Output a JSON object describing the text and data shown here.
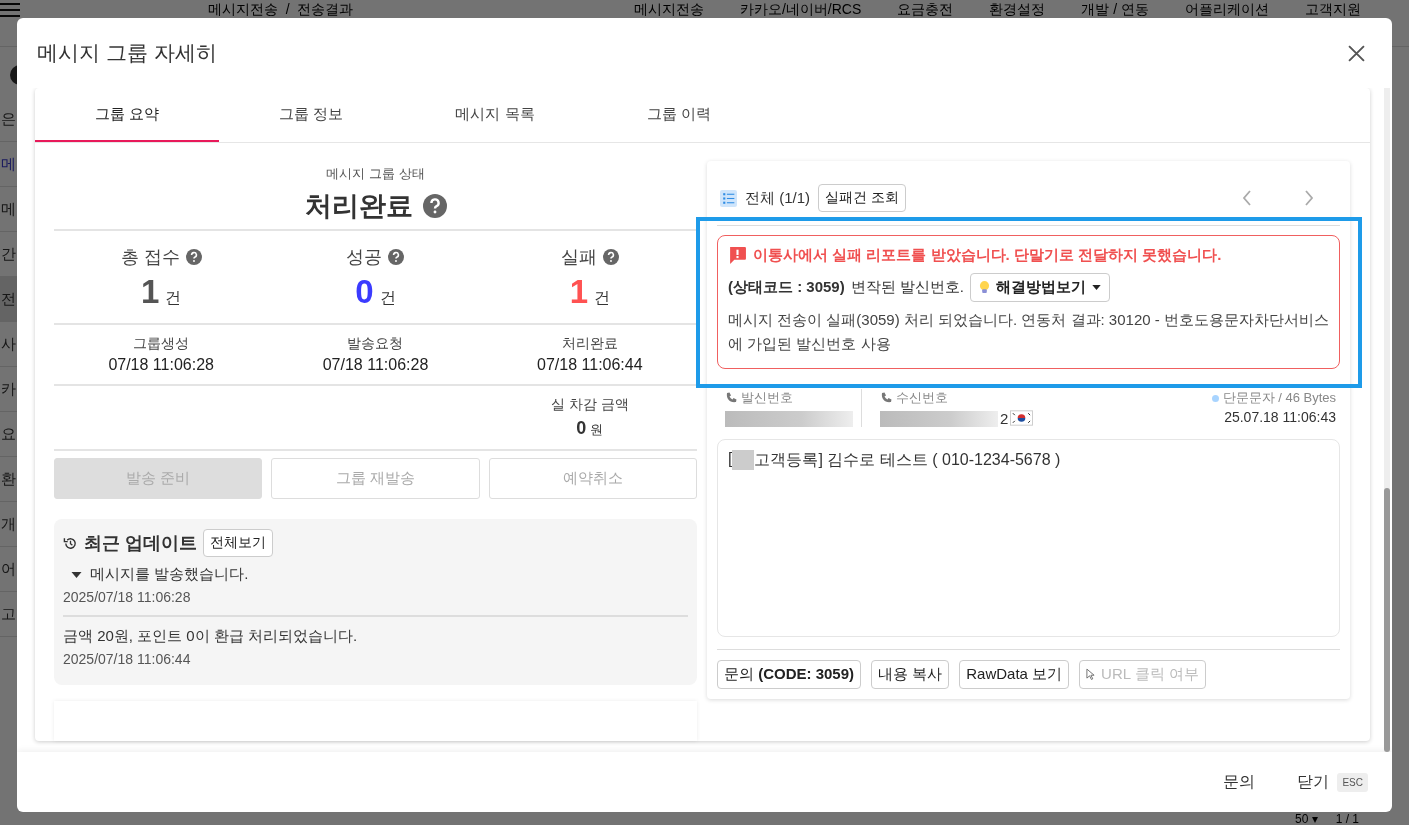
{
  "page": {
    "breadcrumb": "메시지전송  /  전송결과",
    "nav": [
      "메시지전송",
      "카카오/네이버/RCS",
      "요금충전",
      "환경설정",
      "개발 / 연동",
      "어플리케이션",
      "고객지원"
    ],
    "sidebar": [
      {
        "label": "은",
        "selected": false
      },
      {
        "label": "메",
        "selected": false
      },
      {
        "label": "메",
        "selected": false
      },
      {
        "label": "간",
        "selected": false
      },
      {
        "label": "전",
        "selected": true
      },
      {
        "label": "사",
        "selected": false
      },
      {
        "label": "카",
        "selected": false
      },
      {
        "label": "요",
        "selected": false
      },
      {
        "label": "환",
        "selected": false
      },
      {
        "label": "개",
        "selected": false
      },
      {
        "label": "어",
        "selected": false
      },
      {
        "label": "고",
        "selected": false
      }
    ],
    "pager": {
      "page_size": "50 ▾",
      "page": "1 / 1"
    }
  },
  "modal": {
    "title": "메시지 그룹 자세히",
    "tabs": [
      {
        "label": "그룹 요약",
        "selected": true
      },
      {
        "label": "그룹 정보",
        "selected": false
      },
      {
        "label": "메시지 목록",
        "selected": false
      },
      {
        "label": "그룹 이력",
        "selected": false
      }
    ],
    "summary": {
      "status_label": "메시지 그룹 상태",
      "status": "처리완료",
      "stats": [
        {
          "label": "총 접수",
          "value": "1",
          "unit": "건",
          "color": "#555555"
        },
        {
          "label": "성공",
          "value": "0",
          "unit": "건",
          "color": "#3b3bff"
        },
        {
          "label": "실패",
          "value": "1",
          "unit": "건",
          "color": "#ff5252"
        }
      ],
      "times": [
        {
          "label": "그룹생성",
          "value": "07/18 11:06:28"
        },
        {
          "label": "발송요청",
          "value": "07/18 11:06:28"
        },
        {
          "label": "처리완료",
          "value": "07/18 11:06:44"
        }
      ],
      "amount": {
        "label": "실 차감 금액",
        "value": "0",
        "unit": "원"
      },
      "actions": [
        {
          "label": "발송 준비",
          "kind": "filled",
          "disabled": true
        },
        {
          "label": "그룹 재발송",
          "kind": "outline",
          "disabled": true
        },
        {
          "label": "예약취소",
          "kind": "outline",
          "disabled": true
        }
      ]
    },
    "updates": {
      "title": "최근 업데이트",
      "view_all": "전체보기",
      "items": [
        {
          "text": "메시지를 발송했습니다.",
          "time": "2025/07/18 11:06:28",
          "expandable": true
        },
        {
          "text": "금액 20원, 포인트 0이 환급 처리되었습니다.",
          "time": "2025/07/18 11:06:44",
          "expandable": false
        }
      ]
    },
    "message_detail": {
      "count": "전체 (1/1)",
      "filter_button": "실패건 조회",
      "error": {
        "headline": "이통사에서 실패 리포트를 받았습니다. 단말기로 전달하지 못했습니다.",
        "code": "(상태코드 : 3059)",
        "reason": "변작된 발신번호.",
        "solution_button": "해결방법보기",
        "description": "메시지 전송이 실패(3059) 처리 되었습니다. 연동처 결과: 30120 - 번호도용문자차단서비스에 가입된 발신번호 사용"
      },
      "sender_label": "발신번호",
      "receiver_label": "수신번호",
      "receiver_tail": "2",
      "type": "단문문자 / 46 Bytes",
      "sent_at": "25.07.18 11:06:43",
      "message_prefix": "[",
      "message_text": "고객등록] 김수로 테스트 ( 010-1234-5678 )",
      "actions": [
        {
          "label": "문의 **(CODE: 3059)**",
          "disabled": false,
          "kind": "text"
        },
        {
          "label": "내용 복사",
          "disabled": false,
          "kind": "text"
        },
        {
          "label": "RawData 보기",
          "disabled": false,
          "kind": "text"
        },
        {
          "label": "URL 클릭 여부",
          "disabled": true,
          "kind": "cursor"
        }
      ]
    },
    "footer": {
      "inquiry": "문의",
      "close": "닫기",
      "close_key": "ESC"
    }
  }
}
